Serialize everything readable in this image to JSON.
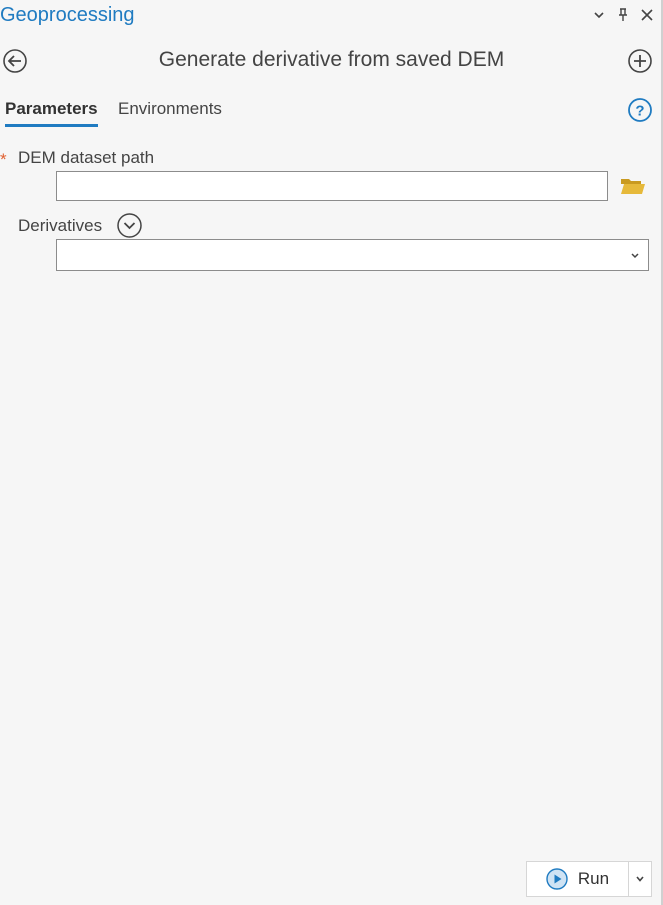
{
  "pane": {
    "title": "Geoprocessing",
    "controls": {
      "options_icon": "chevron-down-icon",
      "pin_icon": "pin-icon",
      "close_icon": "close-icon"
    }
  },
  "tool": {
    "title": "Generate derivative from saved DEM",
    "back_icon": "circle-arrow-left-icon",
    "add_icon": "circle-plus-icon"
  },
  "tabs": [
    {
      "label": "Parameters",
      "active": true
    },
    {
      "label": "Environments",
      "active": false
    }
  ],
  "help_icon": "help-icon",
  "parameters": {
    "dem_path": {
      "label": "DEM dataset path",
      "required_mark": "*",
      "value": "",
      "placeholder": ""
    },
    "derivatives": {
      "label": "Derivatives",
      "selected": ""
    }
  },
  "run_button": {
    "label": "Run"
  },
  "colors": {
    "accent": "#1f7bc1",
    "required": "#e06030",
    "folder": "#e6b93a",
    "background": "#f6f6f6"
  }
}
